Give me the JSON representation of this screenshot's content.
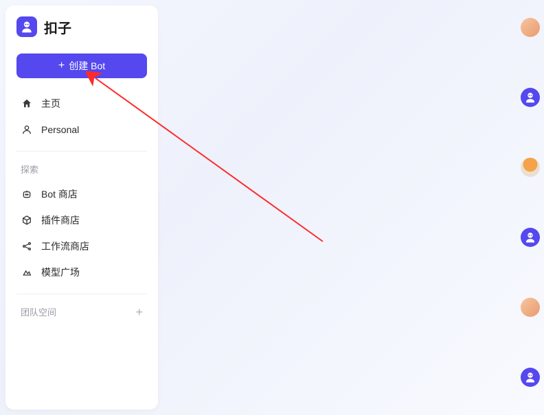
{
  "brand": {
    "name": "扣子"
  },
  "create_button": {
    "label": "创建 Bot"
  },
  "nav_primary": [
    {
      "icon": "home",
      "label": "主页"
    },
    {
      "icon": "user",
      "label": "Personal"
    }
  ],
  "sections": [
    {
      "title": "探索",
      "items": [
        {
          "icon": "bot",
          "label": "Bot 商店"
        },
        {
          "icon": "cube",
          "label": "插件商店"
        },
        {
          "icon": "share",
          "label": "工作流商店"
        },
        {
          "icon": "triangles",
          "label": "模型广场"
        }
      ]
    },
    {
      "title": "团队空间",
      "has_add": true,
      "items": []
    }
  ]
}
